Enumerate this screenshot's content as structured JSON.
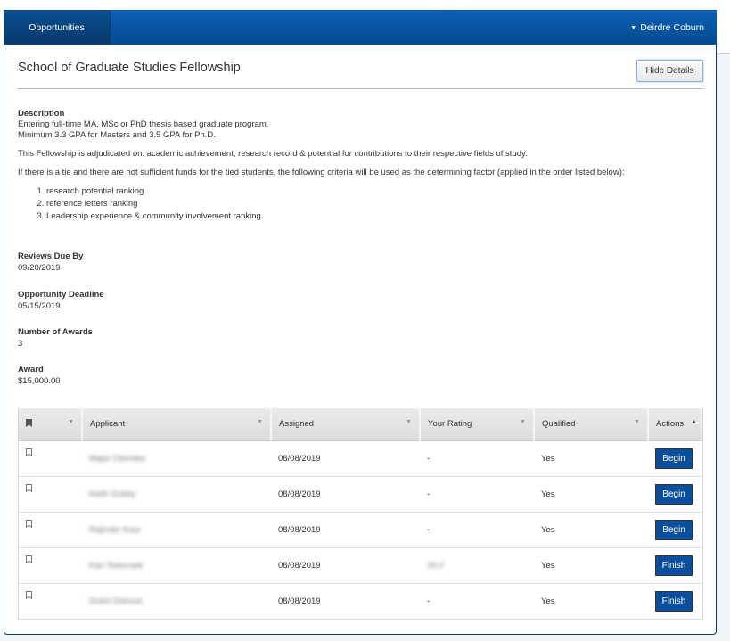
{
  "nav": {
    "tab_label": "Opportunities",
    "user_name": "Deirdre Coburn",
    "user_caret": "▼"
  },
  "header": {
    "title": "School of Graduate Studies Fellowship",
    "hide_details_label": "Hide Details"
  },
  "description": {
    "label": "Description",
    "line1": "Entering full-time MA, MSc or PhD thesis based graduate program.",
    "line2": "Minimum 3.3 GPA for Masters and 3.5 GPA for Ph.D.",
    "para1": "This Fellowship is adjudicated on: academic achievement, research record & potential for contributions to their respective fields of study.",
    "para2": "If there is a tie and there are not sufficient funds for the tied students, the following criteria will be used as the determining factor (applied in the order listed below):",
    "criteria": [
      "research potential ranking",
      "reference letters ranking",
      "Leadership experience & community involvement ranking"
    ]
  },
  "fields": {
    "reviews_due": {
      "label": "Reviews Due By",
      "value": "09/20/2019"
    },
    "deadline": {
      "label": "Opportunity Deadline",
      "value": "05/15/2019"
    },
    "num_awards": {
      "label": "Number of Awards",
      "value": "3"
    },
    "award": {
      "label": "Award",
      "value": "$15,000.00"
    }
  },
  "table": {
    "columns": [
      "",
      "Applicant",
      "Assigned",
      "Your Rating",
      "Qualified",
      "Actions"
    ],
    "sort_caret_down": "▼",
    "sort_caret_up": "▲",
    "rows": [
      {
        "applicant": "Major Clemsko",
        "assigned": "08/08/2019",
        "rating": "-",
        "qualified": "Yes",
        "action": "Begin"
      },
      {
        "applicant": "Keith Gubby",
        "assigned": "08/08/2019",
        "rating": "-",
        "qualified": "Yes",
        "action": "Begin"
      },
      {
        "applicant": "Rajinder Kaur",
        "assigned": "08/08/2019",
        "rating": "-",
        "qualified": "Yes",
        "action": "Begin"
      },
      {
        "applicant": "Kari Teesmark",
        "assigned": "08/08/2019",
        "rating": "34.0",
        "qualified": "Yes",
        "action": "Finish"
      },
      {
        "applicant": "Grant Ostrous",
        "assigned": "08/08/2019",
        "rating": "-",
        "qualified": "Yes",
        "action": "Finish"
      }
    ]
  }
}
